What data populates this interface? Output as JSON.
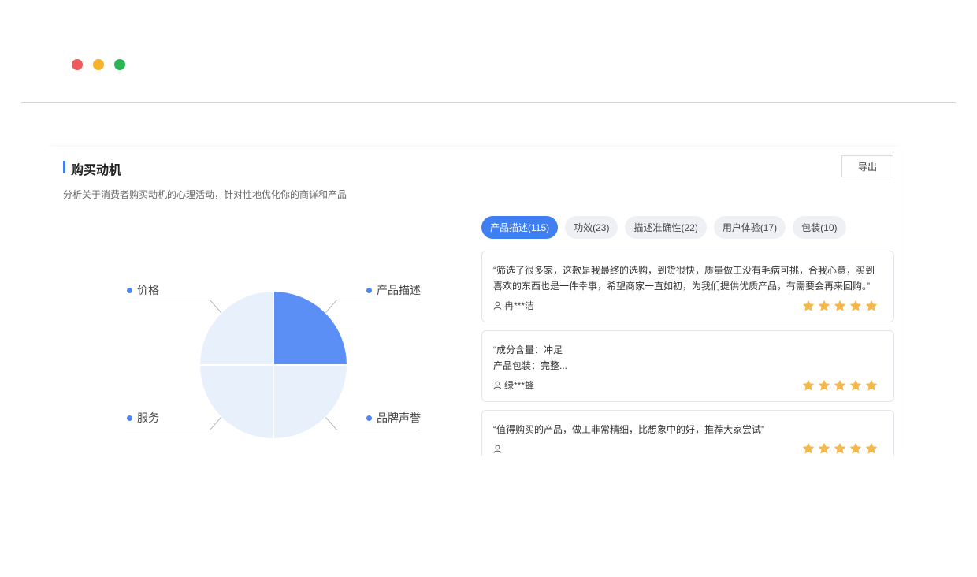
{
  "section": {
    "title": "购买动机",
    "subtitle": "分析关于消费者购买动机的心理活动，针对性地优化你的商详和产品",
    "export_label": "导出"
  },
  "colors": {
    "accent": "#3f7ff2",
    "slice_highlight": "#5b8ff5",
    "slice_muted": "#e8f0fc",
    "star": "#f5b84d"
  },
  "chart_data": {
    "type": "pie",
    "slices": [
      {
        "label": "产品描述",
        "value": 25,
        "highlight": true
      },
      {
        "label": "品牌声誉",
        "value": 25,
        "highlight": false
      },
      {
        "label": "服务",
        "value": 25,
        "highlight": false
      },
      {
        "label": "价格",
        "value": 25,
        "highlight": false
      }
    ]
  },
  "tabs": [
    {
      "label": "产品描述(115)",
      "active": true
    },
    {
      "label": "功效(23)",
      "active": false
    },
    {
      "label": "描述准确性(22)",
      "active": false
    },
    {
      "label": "用户体验(17)",
      "active": false
    },
    {
      "label": "包装(10)",
      "active": false
    }
  ],
  "reviews": [
    {
      "text": "“筛选了很多家，这款是我最终的选购，到货很快，质量做工没有毛病可挑，合我心意，买到喜欢的东西也是一件幸事，希望商家一直如初，为我们提供优质产品，有需要会再来回购。”",
      "user": "冉***洁",
      "rating": 5
    },
    {
      "text": "“成分含量：冲足\n产品包装：完整...",
      "user": "绿***蜂",
      "rating": 5
    },
    {
      "text": "“值得购买的产品，做工非常精细，比想象中的好，推荐大家尝试”",
      "user": "",
      "rating": 5
    }
  ]
}
